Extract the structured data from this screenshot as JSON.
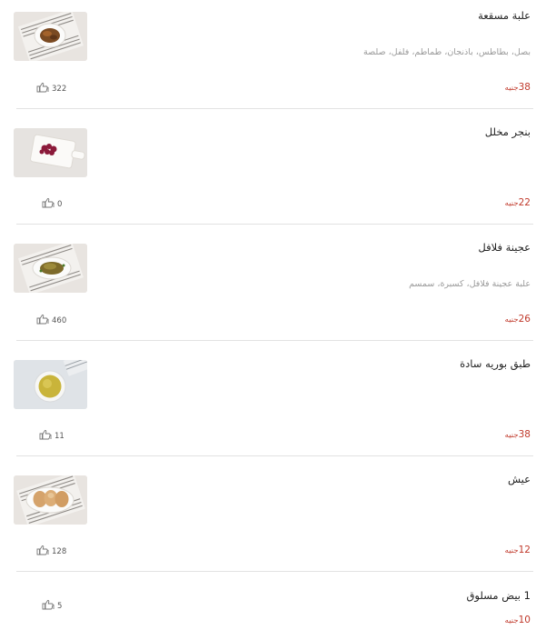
{
  "currency_label": "جنيه",
  "items": [
    {
      "title": "علبة مسقعة",
      "description": "بصل، بطاطس، باذنجان، طماطم، فلفل، صلصة",
      "price": "38",
      "likes": "322",
      "image": "mesakaa-plate"
    },
    {
      "title": "بنجر مخلل",
      "description": "",
      "price": "22",
      "likes": "0",
      "image": "pickled-beet-board"
    },
    {
      "title": "عجينة فلافل",
      "description": "علبة عجينة فلافل، كسبرة، سمسم",
      "price": "26",
      "likes": "460",
      "image": "falafel-plate"
    },
    {
      "title": "طبق بوريه سادة",
      "description": "",
      "price": "38",
      "likes": "11",
      "image": "puree-bowl"
    },
    {
      "title": "عيش",
      "description": "",
      "price": "12",
      "likes": "128",
      "image": "bread-plate"
    },
    {
      "title": "1 بيض مسلوق",
      "description": "",
      "price": "10",
      "likes": "5",
      "image": ""
    }
  ],
  "colors": {
    "price": "#c0392b",
    "description": "#9a9a9a",
    "separator": "#e2e2e2"
  },
  "icons": {
    "likes": "thumbs-up-icon"
  }
}
